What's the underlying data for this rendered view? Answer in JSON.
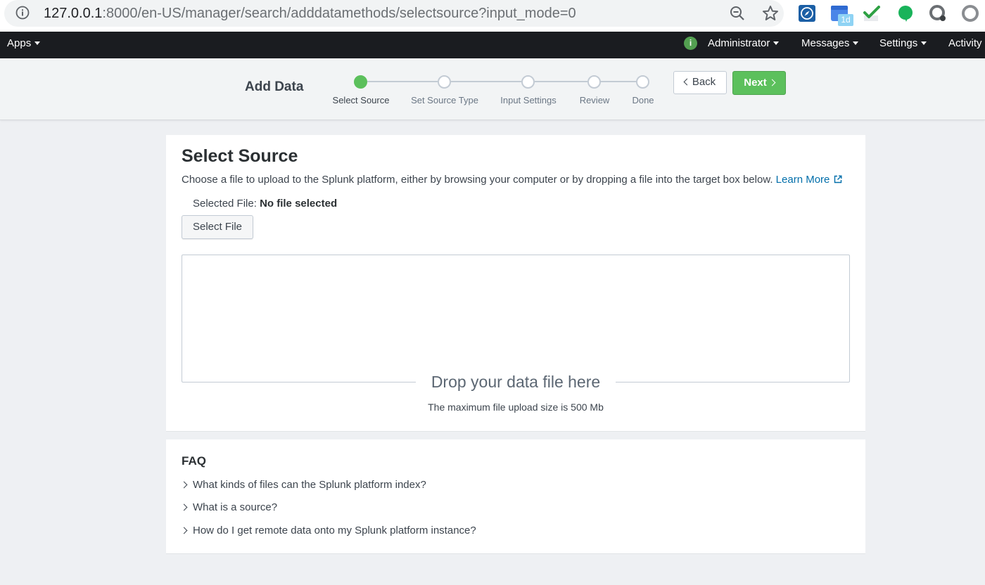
{
  "browser": {
    "url_host": "127.0.0.1",
    "url_path": ":8000/en-US/manager/search/adddatamethods/selectsource?input_mode=0",
    "extension_badge": "1d"
  },
  "topnav": {
    "apps": "Apps",
    "status_icon": "i",
    "administrator": "Administrator",
    "messages": "Messages",
    "settings": "Settings",
    "activity": "Activity"
  },
  "wizard": {
    "title": "Add Data",
    "steps": [
      {
        "label": "Select Source",
        "active": true
      },
      {
        "label": "Set Source Type",
        "active": false
      },
      {
        "label": "Input Settings",
        "active": false
      },
      {
        "label": "Review",
        "active": false
      },
      {
        "label": "Done",
        "active": false
      }
    ],
    "back_label": "Back",
    "next_label": "Next"
  },
  "select_source": {
    "heading": "Select Source",
    "description": "Choose a file to upload to the Splunk platform, either by browsing your computer or by dropping a file into the target box below.",
    "learn_more": "Learn More",
    "selected_file_label": "Selected File:",
    "selected_file_value": "No file selected",
    "select_file_button": "Select File",
    "drop_title": "Drop your data file here",
    "max_size": "The maximum file upload size is 500 Mb"
  },
  "faq": {
    "heading": "FAQ",
    "items": [
      "What kinds of files can the Splunk platform index?",
      "What is a source?",
      "How do I get remote data onto my Splunk platform instance?"
    ]
  },
  "colors": {
    "accent_green": "#5cc05c",
    "nav_bg": "#1a1c20",
    "link_blue": "#006eaa"
  }
}
